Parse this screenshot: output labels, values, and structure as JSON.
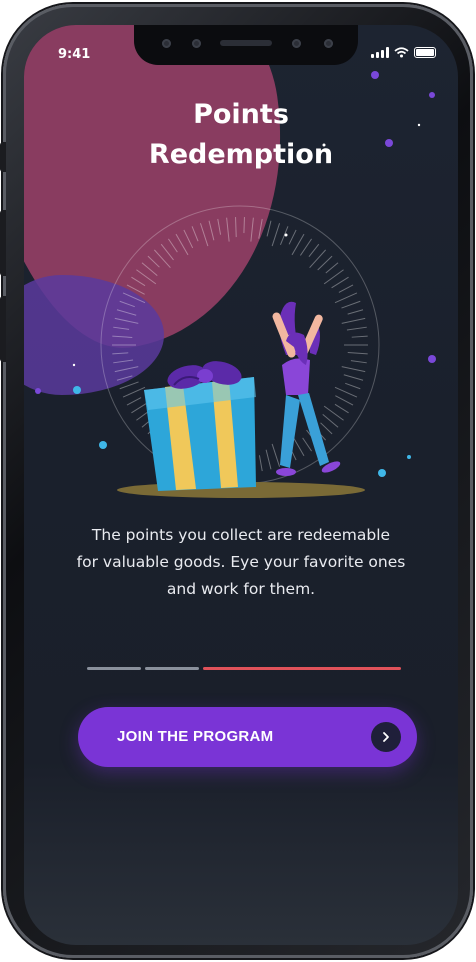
{
  "status_bar": {
    "time": "9:41"
  },
  "onboarding": {
    "title_line1": "Points",
    "title_line2": "Redemption",
    "description_line1": "The points you collect are redeemable",
    "description_line2": "for valuable goods. Eye your favorite ones",
    "description_line3": "and work for them.",
    "progress": {
      "total_steps": 3,
      "current_step": 3
    },
    "cta_label": "JOIN THE PROGRAM"
  },
  "colors": {
    "background": "#1a202c",
    "accent": "#7a34d6",
    "progress_active": "#e0525a",
    "progress_inactive": "#8a909c",
    "blob_pink": "#8f3e63",
    "blob_purple": "#5a3a9e"
  },
  "icons": [
    "chevron-right-icon",
    "signal-icon",
    "wifi-icon",
    "battery-icon",
    "gift-box-icon",
    "woman-celebrating-icon"
  ]
}
